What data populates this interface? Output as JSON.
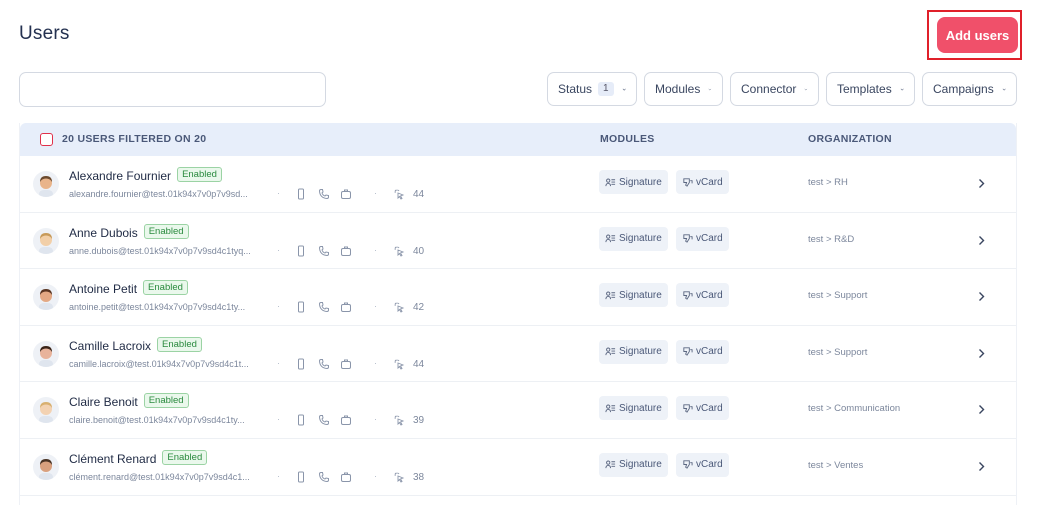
{
  "header": {
    "title": "Users",
    "add_button": "Add users"
  },
  "search": {
    "placeholder": "",
    "value": ""
  },
  "filters": [
    {
      "label": "Status",
      "count": "1"
    },
    {
      "label": "Modules"
    },
    {
      "label": "Connector"
    },
    {
      "label": "Templates"
    },
    {
      "label": "Campaigns"
    }
  ],
  "table": {
    "header": {
      "users": "20 USERS FILTERED ON 20",
      "modules": "MODULES",
      "organization": "ORGANIZATION"
    },
    "module_labels": {
      "signature": "Signature",
      "vcard": "vCard"
    },
    "separator": "·",
    "rows": [
      {
        "name": "Alexandre Fournier",
        "status": "Enabled",
        "email": "alexandre.fournier@test.01k94x7v0p7v9sd...",
        "score": "44",
        "org": "test > RH",
        "avatar_color": "#e9b48a",
        "hair_color": "#6b4a2e"
      },
      {
        "name": "Anne Dubois",
        "status": "Enabled",
        "email": "anne.dubois@test.01k94x7v0p7v9sd4c1tyq...",
        "score": "40",
        "org": "test > R&D",
        "avatar_color": "#f2cfa8",
        "hair_color": "#c79a5a"
      },
      {
        "name": "Antoine Petit",
        "status": "Enabled",
        "email": "antoine.petit@test.01k94x7v0p7v9sd4c1ty...",
        "score": "42",
        "org": "test > Support",
        "avatar_color": "#e3a884",
        "hair_color": "#5a3522"
      },
      {
        "name": "Camille Lacroix",
        "status": "Enabled",
        "email": "camille.lacroix@test.01k94x7v0p7v9sd4c1t...",
        "score": "44",
        "org": "test > Support",
        "avatar_color": "#e8b39b",
        "hair_color": "#3a2418"
      },
      {
        "name": "Claire Benoit",
        "status": "Enabled",
        "email": "claire.benoit@test.01k94x7v0p7v9sd4c1ty...",
        "score": "39",
        "org": "test > Communication",
        "avatar_color": "#f3d2b2",
        "hair_color": "#d8b070"
      },
      {
        "name": "Clément Renard",
        "status": "Enabled",
        "email": "clément.renard@test.01k94x7v0p7v9sd4c1...",
        "score": "38",
        "org": "test > Ventes",
        "avatar_color": "#d9a07e",
        "hair_color": "#4a3324"
      }
    ]
  },
  "colors": {
    "accent": "#f0506a",
    "highlight": "#e0202a",
    "header_bg": "#e7eefa",
    "badge_green": "#2a8a3e"
  }
}
